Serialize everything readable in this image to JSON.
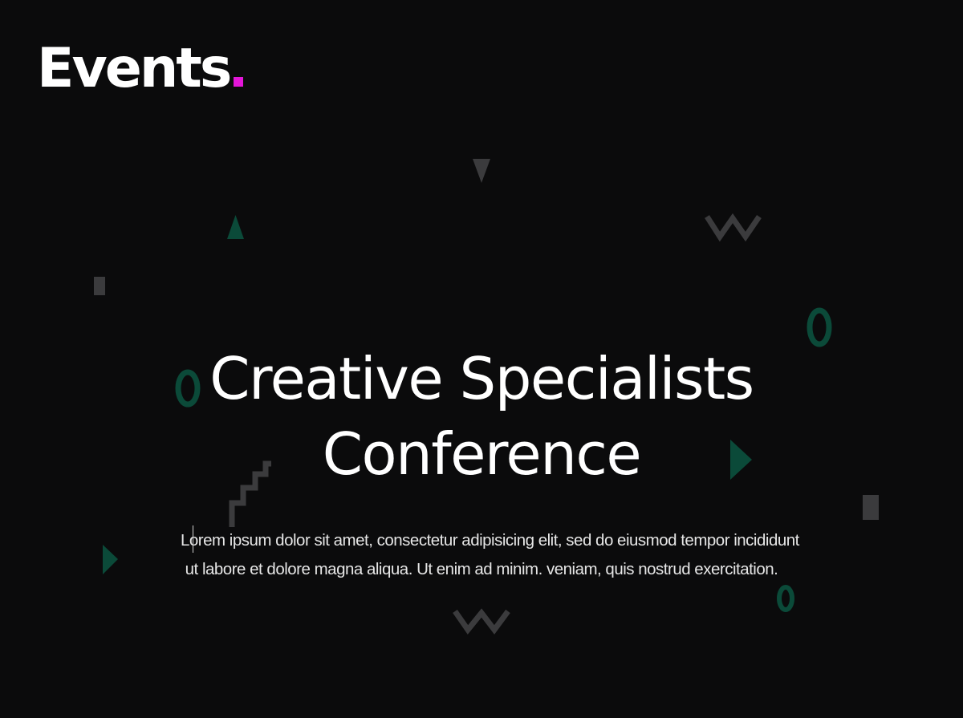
{
  "header": {
    "logo_text": "Events",
    "logo_dot_color": "#e416d9"
  },
  "hero": {
    "title_line1": "Creative Specialists",
    "title_line2": "Conference",
    "description_line1": "Lorem ipsum dolor sit amet, consectetur adipisicing elit, sed do eiusmod tempor incididunt",
    "description_line2": "ut labore et dolore magna aliqua. Ut enim ad minim. veniam, quis nostrud exercitation."
  },
  "decor": {
    "gray_shape_color": "#3b3b3d",
    "green_shape_color": "#0b4a39",
    "icons": [
      "triangle-icon",
      "zigzag-icon",
      "square-icon",
      "ring-icon",
      "play-triangle-icon",
      "staircase-icon",
      "text-caret"
    ]
  }
}
